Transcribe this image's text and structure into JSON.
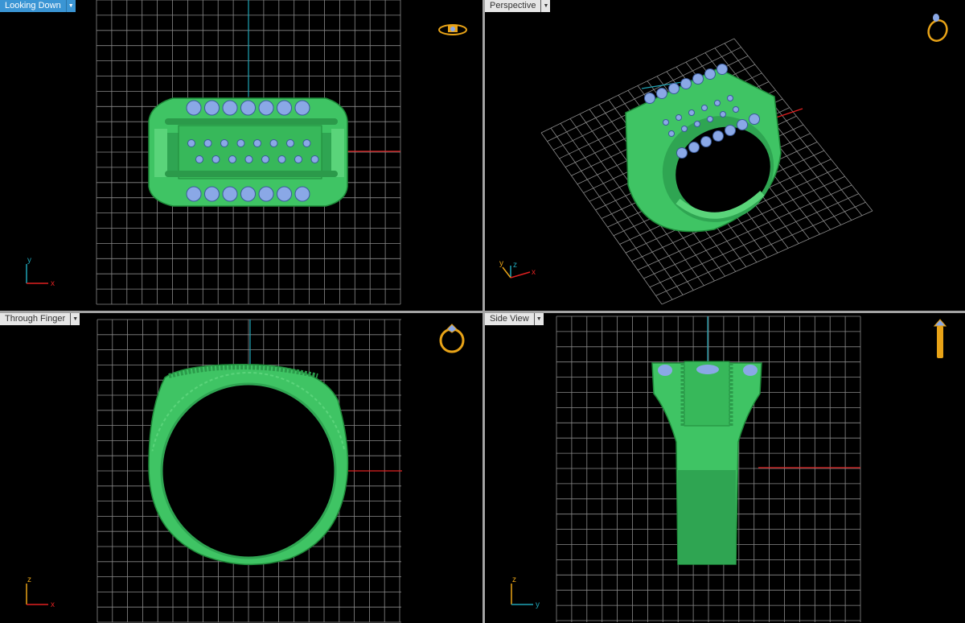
{
  "viewports": [
    {
      "id": "top-left",
      "label": "Looking Down",
      "active": true,
      "axes": {
        "vertical": "y",
        "horizontal": "x"
      }
    },
    {
      "id": "top-right",
      "label": "Perspective",
      "active": false,
      "axes": {
        "vertical": "z",
        "horizontal": "x",
        "depth": "y"
      }
    },
    {
      "id": "bottom-left",
      "label": "Through Finger",
      "active": false,
      "axes": {
        "vertical": "z",
        "horizontal": "x"
      }
    },
    {
      "id": "bottom-right",
      "label": "Side View",
      "active": false,
      "axes": {
        "vertical": "z",
        "horizontal": "y"
      }
    }
  ],
  "colors": {
    "background": "#000000",
    "grid": "#8a8a8a",
    "model": "#3fc464",
    "gems": "#8aa8e6",
    "axis_x": "#e02020",
    "axis_y": "#1fa3b5",
    "view_icon": "#e8a317",
    "active_tab": "#3a95d4"
  },
  "icons": {
    "view_menu": "chevron-down-icon",
    "top_left_view": "ring-top-view-icon",
    "top_right_view": "ring-perspective-icon",
    "bottom_left_view": "ring-front-view-icon",
    "bottom_right_view": "ring-side-view-icon"
  }
}
